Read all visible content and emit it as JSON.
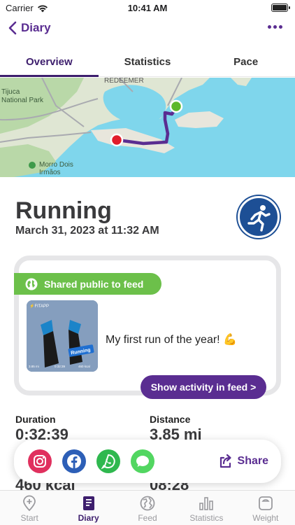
{
  "status": {
    "carrier": "Carrier",
    "time": "10:41 AM"
  },
  "nav": {
    "back_label": "Diary"
  },
  "tabs": [
    {
      "label": "Overview"
    },
    {
      "label": "Statistics"
    },
    {
      "label": "Pace"
    }
  ],
  "map": {
    "labels": [
      "REDEEMER",
      "Tijuca",
      "National Park",
      "Morro Dois",
      "Irmãos"
    ],
    "start_color": "#5cb82a",
    "end_color": "#e11d2b",
    "route_color": "#5a2d91"
  },
  "activity": {
    "title": "Running",
    "date": "March 31, 2023 at 11:32 AM",
    "icon": "running-person-icon"
  },
  "feed": {
    "shared_label": "Shared public to feed",
    "caption": "My first run of the year! 💪",
    "show_button": "Show activity in feed >",
    "thumb": {
      "badge": "Running",
      "stat1": "3.85 mi",
      "stat2": "0:32:39",
      "stat3": "460 kcal"
    }
  },
  "stats": {
    "duration_label": "Duration",
    "duration_value": "0:32:39",
    "distance_label": "Distance",
    "distance_value": "3.85 mi",
    "calories_partial": "460 kcal",
    "pace_partial": "08:28"
  },
  "share": {
    "label": "Share",
    "icons": [
      "instagram-icon",
      "facebook-icon",
      "whatsapp-icon",
      "messages-icon"
    ]
  },
  "tabbar": [
    {
      "label": "Start",
      "icon": "plus-location-icon"
    },
    {
      "label": "Diary",
      "icon": "book-icon"
    },
    {
      "label": "Feed",
      "icon": "globe-icon"
    },
    {
      "label": "Statistics",
      "icon": "bar-chart-icon"
    },
    {
      "label": "Weight",
      "icon": "scale-icon"
    }
  ]
}
